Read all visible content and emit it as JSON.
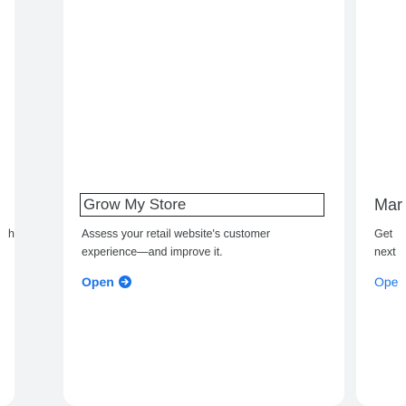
{
  "cards": [
    {
      "title": "",
      "description": "h"
    },
    {
      "title": "Grow My Store",
      "description": "Assess your retail website's customer experience—and improve it.",
      "link_label": "Open",
      "link_icon": "arrow-right-circle-icon"
    },
    {
      "title": "Mar",
      "description_line1": "Get",
      "description_line2": "next",
      "link_label": "Ope"
    }
  ],
  "colors": {
    "background": "#f1f3f4",
    "card": "#ffffff",
    "text": "#3c4043",
    "link": "#1a73e8",
    "focus_outline": "#202124"
  }
}
